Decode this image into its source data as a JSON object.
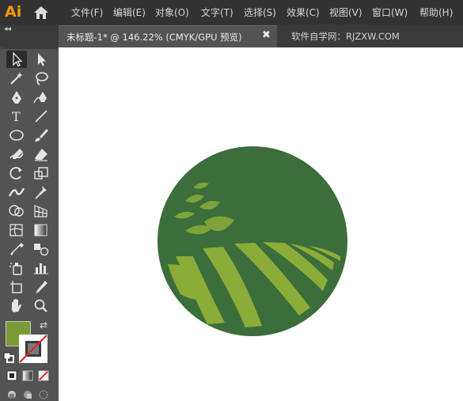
{
  "app": {
    "logo": "Ai",
    "home_icon": "home-icon"
  },
  "menu": [
    {
      "label": "文件(F)"
    },
    {
      "label": "编辑(E)"
    },
    {
      "label": "对象(O)"
    },
    {
      "label": "文字(T)"
    },
    {
      "label": "选择(S)"
    },
    {
      "label": "效果(C)"
    },
    {
      "label": "视图(V)"
    },
    {
      "label": "窗口(W)"
    },
    {
      "label": "帮助(H)"
    }
  ],
  "panel": {
    "collapse": "◂◂"
  },
  "tabs": {
    "active": "未标题-1* @ 146.22% (CMYK/GPU 预览)",
    "close": "✖",
    "site": "软件自学网：RJZXW.COM"
  },
  "colors": {
    "fill": "#7a9b34",
    "badge_bg": "#3b6e3a",
    "leaf": "#7fa33a",
    "field": "#8bac38",
    "chrome_dark": "#323232",
    "toolbar": "#535353",
    "logo": "#ff9a00"
  },
  "toolbar": {
    "swap": "⇄",
    "tools": [
      "selection-tool-icon",
      "direct-selection-tool-icon",
      "magic-wand-tool-icon",
      "lasso-tool-icon",
      "pen-tool-icon",
      "curvature-tool-icon",
      "type-tool-icon",
      "line-segment-tool-icon",
      "ellipse-tool-icon",
      "paintbrush-tool-icon",
      "shaper-tool-icon",
      "eraser-tool-icon",
      "rotate-tool-icon",
      "scale-tool-icon",
      "width-tool-icon",
      "puppet-warp-tool-icon",
      "shape-builder-tool-icon",
      "perspective-grid-tool-icon",
      "mesh-tool-icon",
      "gradient-tool-icon",
      "eyedropper-tool-icon",
      "blend-tool-icon",
      "symbol-sprayer-tool-icon",
      "column-graph-tool-icon",
      "artboard-tool-icon",
      "slice-tool-icon",
      "hand-tool-icon",
      "zoom-tool-icon"
    ]
  }
}
